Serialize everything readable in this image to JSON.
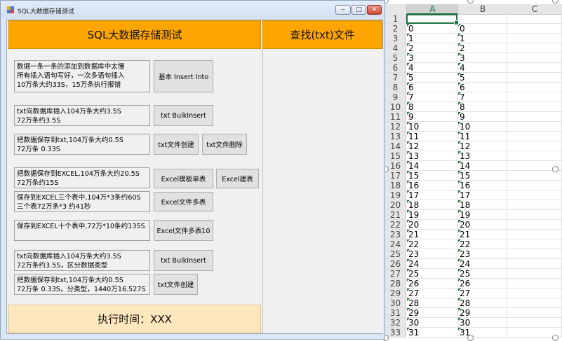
{
  "window": {
    "title": "SQL大数据存储测试",
    "minimize_glyph": "‒",
    "maximize_glyph": "□",
    "close_glyph": "✕"
  },
  "headers": {
    "left": "SQL大数据存储测试",
    "right": "查找(txt)文件"
  },
  "sections": {
    "s1": {
      "desc": "数据一条一条的添加到数据库中太慢\n所有插入语句写好，一次多语句插入\n10万条大约33S，15万条执行报错",
      "btn1": "基本 Insert Into"
    },
    "s2": {
      "desc": "txt向数据库插入104万条大约3.5S\n72万条约3.5S",
      "btn1": "txt BulkInsert"
    },
    "s3": {
      "desc": "把数据保存到txt,104万条大约0.5S\n72万条 0.33S",
      "btn1": "txt文件创建",
      "btn2": "txt文件删除"
    },
    "s4": {
      "desc": "把数据保存到EXCEL,104万条大约20.5S\n72万条约15S",
      "btn1": "Excel模板单表",
      "btn2": "Excel建表"
    },
    "s5": {
      "desc": "保存到EXCEL三个表中,104万*3条约60S\n三个表72万条*3  约41秒",
      "btn1": "Excel文件多表"
    },
    "s6": {
      "desc": "保存到EXCEL十个表中,72万*10条约135S",
      "btn1": "Excel文件多表10"
    },
    "s7": {
      "desc": "txt向数据库插入104万条大约3.5S\n72万条约3.5S，区分数据类型",
      "btn1": "txt BulkInsert"
    },
    "s8": {
      "desc": "把数据保存到txt,104万条大约0.5S\n72万条 0.33S，分类型，1440万16.527S",
      "btn1": "txt文件创建"
    }
  },
  "status": {
    "text": "执行时间：XXX"
  },
  "excel": {
    "columns": [
      "A",
      "B",
      "C"
    ],
    "rows": [
      {
        "n": "1",
        "a": "",
        "b": ""
      },
      {
        "n": "2",
        "a": "0",
        "b": "0"
      },
      {
        "n": "3",
        "a": "1",
        "b": "1"
      },
      {
        "n": "4",
        "a": "2",
        "b": "2"
      },
      {
        "n": "5",
        "a": "3",
        "b": "3"
      },
      {
        "n": "6",
        "a": "4",
        "b": "4"
      },
      {
        "n": "7",
        "a": "5",
        "b": "5"
      },
      {
        "n": "8",
        "a": "6",
        "b": "6"
      },
      {
        "n": "9",
        "a": "7",
        "b": "7"
      },
      {
        "n": "10",
        "a": "8",
        "b": "8"
      },
      {
        "n": "11",
        "a": "9",
        "b": "9"
      },
      {
        "n": "12",
        "a": "10",
        "b": "10"
      },
      {
        "n": "13",
        "a": "11",
        "b": "11"
      },
      {
        "n": "14",
        "a": "12",
        "b": "12"
      },
      {
        "n": "15",
        "a": "13",
        "b": "13"
      },
      {
        "n": "16",
        "a": "14",
        "b": "14"
      },
      {
        "n": "17",
        "a": "15",
        "b": "15"
      },
      {
        "n": "18",
        "a": "16",
        "b": "16"
      },
      {
        "n": "19",
        "a": "17",
        "b": "17"
      },
      {
        "n": "20",
        "a": "18",
        "b": "18"
      },
      {
        "n": "21",
        "a": "19",
        "b": "19"
      },
      {
        "n": "22",
        "a": "20",
        "b": "20"
      },
      {
        "n": "23",
        "a": "21",
        "b": "21"
      },
      {
        "n": "24",
        "a": "22",
        "b": "22"
      },
      {
        "n": "25",
        "a": "23",
        "b": "23"
      },
      {
        "n": "26",
        "a": "24",
        "b": "24"
      },
      {
        "n": "27",
        "a": "25",
        "b": "25"
      },
      {
        "n": "28",
        "a": "26",
        "b": "26"
      },
      {
        "n": "29",
        "a": "27",
        "b": "27"
      },
      {
        "n": "30",
        "a": "28",
        "b": "28"
      },
      {
        "n": "31",
        "a": "29",
        "b": "29"
      },
      {
        "n": "32",
        "a": "30",
        "b": "30"
      },
      {
        "n": "33",
        "a": "31",
        "b": "31"
      }
    ]
  },
  "colors": {
    "header_orange": "#ffa500",
    "status_bg": "#ffe7bd",
    "excel_green": "#217346"
  }
}
